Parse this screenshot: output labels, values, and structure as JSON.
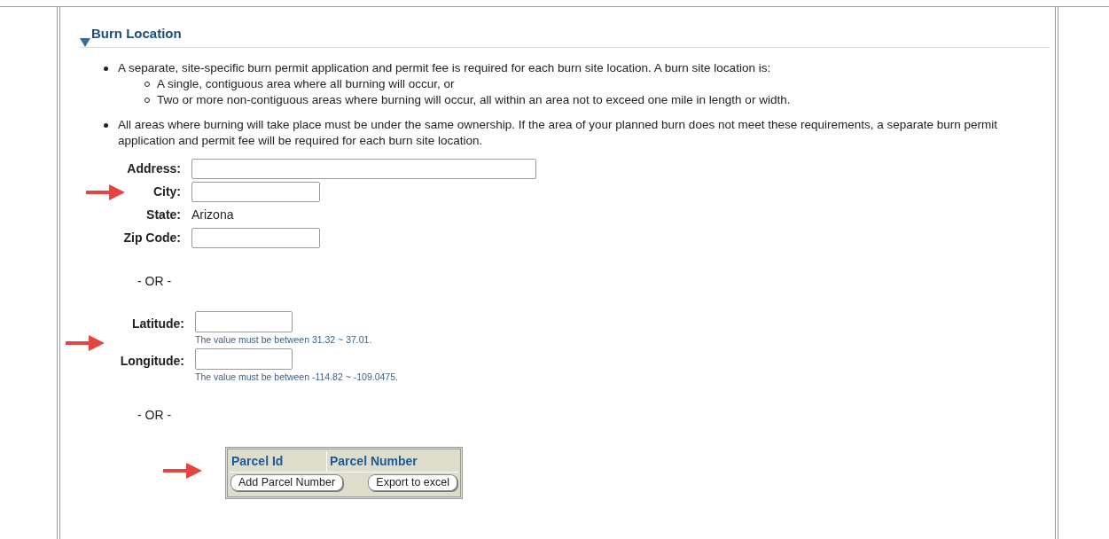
{
  "section": {
    "title": "Burn Location",
    "expanded": true
  },
  "bullets": [
    {
      "text": "A separate, site-specific burn permit application and permit fee is required for each burn site location. A burn site location is:",
      "children": [
        {
          "text": "A single, contiguous area where all burning will occur, or"
        },
        {
          "text": "Two or more non-contiguous areas where burning will occur, all within an area not to exceed one mile in length or width."
        }
      ]
    },
    {
      "text": "All areas where burning will take place must be under the same ownership. If the area of your planned burn does not meet these requirements, a separate burn permit application and permit fee will be required for each burn site location."
    }
  ],
  "address_fields": [
    {
      "label": "Address:",
      "kind": "wide_input"
    },
    {
      "label": "City:",
      "kind": "input"
    },
    {
      "label": "State:",
      "kind": "text",
      "value": "Arizona"
    },
    {
      "label": "Zip Code:",
      "kind": "input"
    }
  ],
  "or_1": "- OR -",
  "coordinate_fields": [
    {
      "label": "Latitude:",
      "hint": "The value must be between 31.32 ~ 37.01."
    },
    {
      "label": "Longitude:",
      "hint": "The value must be between -114.82 ~ -109.0475."
    }
  ],
  "or_2": "- OR -",
  "parcel_table": {
    "columns": [
      "Parcel Id",
      "Parcel Number"
    ],
    "buttons": [
      "Add Parcel Number",
      "Export to excel"
    ]
  }
}
